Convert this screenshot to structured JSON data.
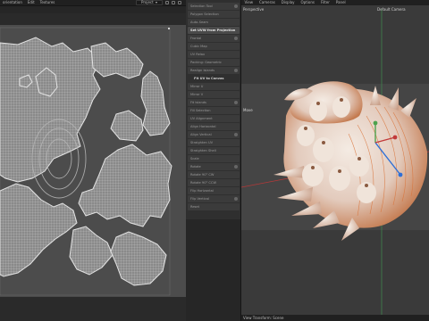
{
  "uv_editor": {
    "menu": [
      "orientation",
      "Edit",
      "Textures"
    ],
    "view_dropdown": "Project"
  },
  "tool_panel": {
    "items": [
      {
        "label": "Selection Tool",
        "style": "item"
      },
      {
        "label": "Polygon Selection",
        "style": "item"
      },
      {
        "label": "Auto-Seam",
        "style": "item"
      },
      {
        "label": "Set UVW from Projection",
        "style": "highlight"
      },
      {
        "label": "Frontal",
        "style": "item"
      },
      {
        "label": "Cubic Map",
        "style": "item"
      },
      {
        "label": "UV Relax",
        "style": "item"
      },
      {
        "label": "Packing: Geometric",
        "style": "item"
      },
      {
        "label": "Realign Islands",
        "style": "item"
      },
      {
        "label": "Fit UV to Canvas",
        "style": "heading"
      },
      {
        "label": "Mirror U",
        "style": "item"
      },
      {
        "label": "Mirror V",
        "style": "item"
      },
      {
        "label": "Fit Islands",
        "style": "item"
      },
      {
        "label": "Fill Selection",
        "style": "item"
      },
      {
        "label": "UV Alignment",
        "style": "item"
      },
      {
        "label": "Align Horizontal",
        "style": "item"
      },
      {
        "label": "Align Vertical",
        "style": "item"
      },
      {
        "label": "Straighten UV",
        "style": "item"
      },
      {
        "label": "Straighten Shell",
        "style": "item"
      },
      {
        "label": "Scale",
        "style": "item"
      },
      {
        "label": "Rotate",
        "style": "item"
      },
      {
        "label": "Rotate 90° CW",
        "style": "item"
      },
      {
        "label": "Rotate 90° CCW",
        "style": "item"
      },
      {
        "label": "Flip Horizontal",
        "style": "item"
      },
      {
        "label": "Flip Vertical",
        "style": "item"
      },
      {
        "label": "Reset",
        "style": "item"
      }
    ]
  },
  "viewport": {
    "menu": [
      "View",
      "Cameras",
      "Display",
      "Options",
      "Filter",
      "Panel"
    ],
    "perspective_label": "Perspective",
    "camera_label": "Default Camera",
    "mode_label": "Move",
    "footer_label": "View Transform: Scene"
  },
  "colors": {
    "uv_mesh_fill": "#8a8a8a",
    "uv_mesh_wire": "#d8d8d8",
    "shell_base": "#e8ddd3",
    "shell_orange": "#d9743a",
    "axis_red": "#c23a3a",
    "axis_green": "#4ea24e"
  }
}
